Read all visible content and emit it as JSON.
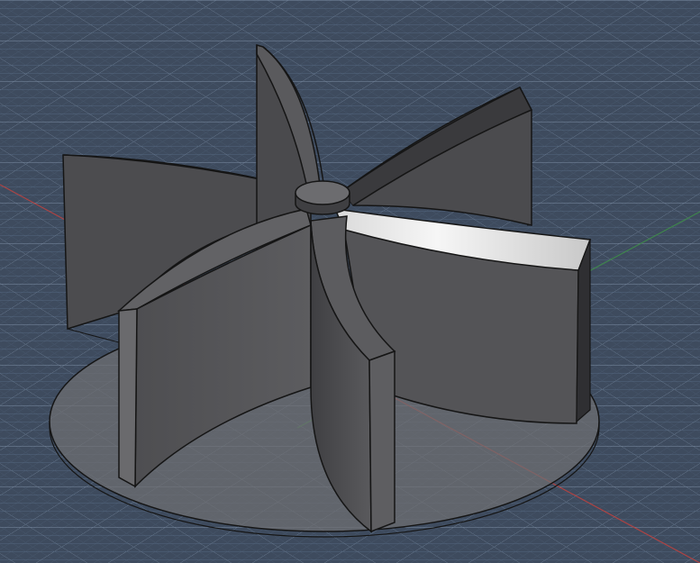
{
  "viewport": {
    "background": "#3e4b5e",
    "grid_minor_color": "#566a84",
    "grid_major_color": "#7f91a8",
    "axis_x_color": "#c0423f",
    "axis_y_color": "#3f8f4a"
  },
  "model": {
    "name": "impeller",
    "blade_count": 6,
    "base_shape": "disc",
    "hub_shape": "cylinder",
    "base_color": "#6f6f72",
    "blade_dark": "#4a4a4d",
    "blade_mid": "#58585b",
    "blade_light": "#6d6d70",
    "highlight": "#f2f2f2",
    "edge_color": "#151515"
  }
}
